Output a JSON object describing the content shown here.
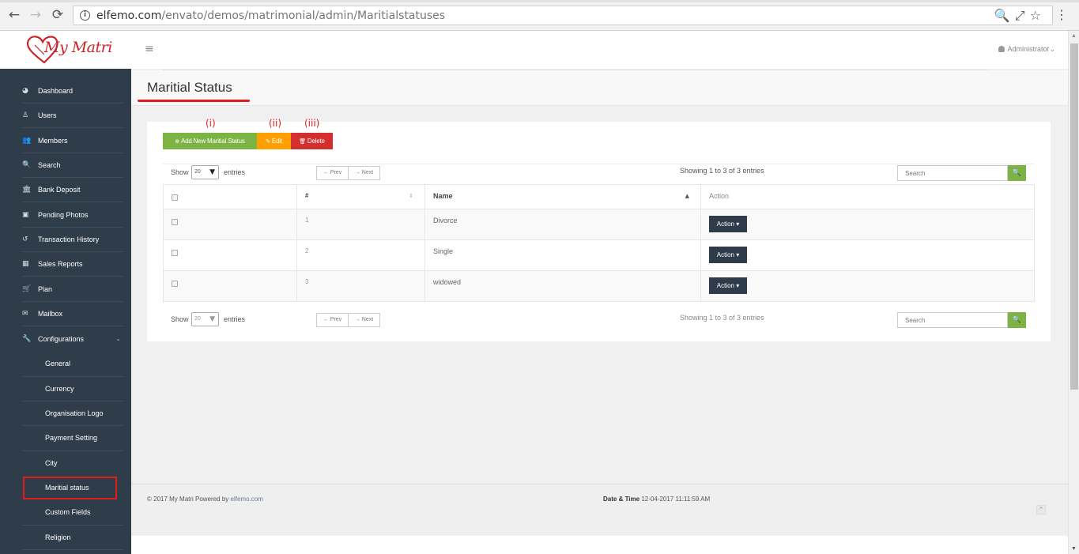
{
  "browser": {
    "back": "←",
    "forward": "→",
    "reload": "⟳",
    "url_host": "elfemo.com",
    "url_path": "/envato/demos/matrimonial/admin/Maritialstatuses",
    "zoom_icon": "🔍",
    "share_icon": "⤢",
    "star_icon": "☆",
    "menu_icon": "⋮"
  },
  "header": {
    "logo_text": "My Matri",
    "hamburger": "≡",
    "admin_label": "Administrator",
    "admin_caret": "⌄"
  },
  "sidebar": {
    "items": [
      {
        "label": "Dashboard",
        "icon": "◕"
      },
      {
        "label": "Users",
        "icon": "♙"
      },
      {
        "label": "Members",
        "icon": "👥"
      },
      {
        "label": "Search",
        "icon": "🔍"
      },
      {
        "label": "Bank Deposit",
        "icon": "🏛"
      },
      {
        "label": "Pending Photos",
        "icon": "▣"
      },
      {
        "label": "Transaction History",
        "icon": "↺"
      },
      {
        "label": "Sales Reports",
        "icon": "▦"
      },
      {
        "label": "Plan",
        "icon": "🛒"
      },
      {
        "label": "Mailbox",
        "icon": "✉"
      },
      {
        "label": "Configurations",
        "icon": "🔧",
        "chevron": "⌄"
      }
    ],
    "sub_items": [
      "General",
      "Currency",
      "Organisation Logo",
      "Payment Setting",
      "City",
      "Maritial status",
      "Custom Fields",
      "Religion"
    ]
  },
  "page": {
    "title": "Maritial Status",
    "annotations": [
      "(i)",
      "(ii)",
      "(iii)"
    ],
    "buttons": {
      "add": "Add New Maritial Status",
      "add_icon": "⊕",
      "edit": "Edit",
      "edit_icon": "✎",
      "delete": "Delete",
      "delete_icon": "🗑"
    },
    "show_label": "Show",
    "page_size": "20",
    "select_arrow": "▼",
    "entries_label": "entries",
    "prev": "← Prev",
    "next": "→ Next",
    "showing": "Showing 1 to 3 of 3 entries",
    "search_placeholder": "Search",
    "search_icon": "🔍",
    "columns": [
      "#",
      "Name",
      "Action"
    ],
    "sort_icons": [
      "⇕",
      "▲"
    ],
    "rows": [
      {
        "num": "1",
        "name": "Divorce",
        "action": "Action ▾"
      },
      {
        "num": "2",
        "name": "Single",
        "action": "Action ▾"
      },
      {
        "num": "3",
        "name": "widowed",
        "action": "Action ▾"
      }
    ]
  },
  "footer": {
    "copyright": "© 2017 My Matri Powered by ",
    "copyright_link": "elfemo.com",
    "date_label": "Date & Time",
    "date_value": " 12-04-2017 11:11:59 AM",
    "to_top": "^"
  },
  "colors": {
    "sidebar_bg": "#2f3d4a",
    "add_btn": "#7cb342",
    "edit_btn": "#ffa000",
    "delete_btn": "#d32f2f",
    "action_btn": "#2d3b4a",
    "highlight": "#e21b1b"
  }
}
